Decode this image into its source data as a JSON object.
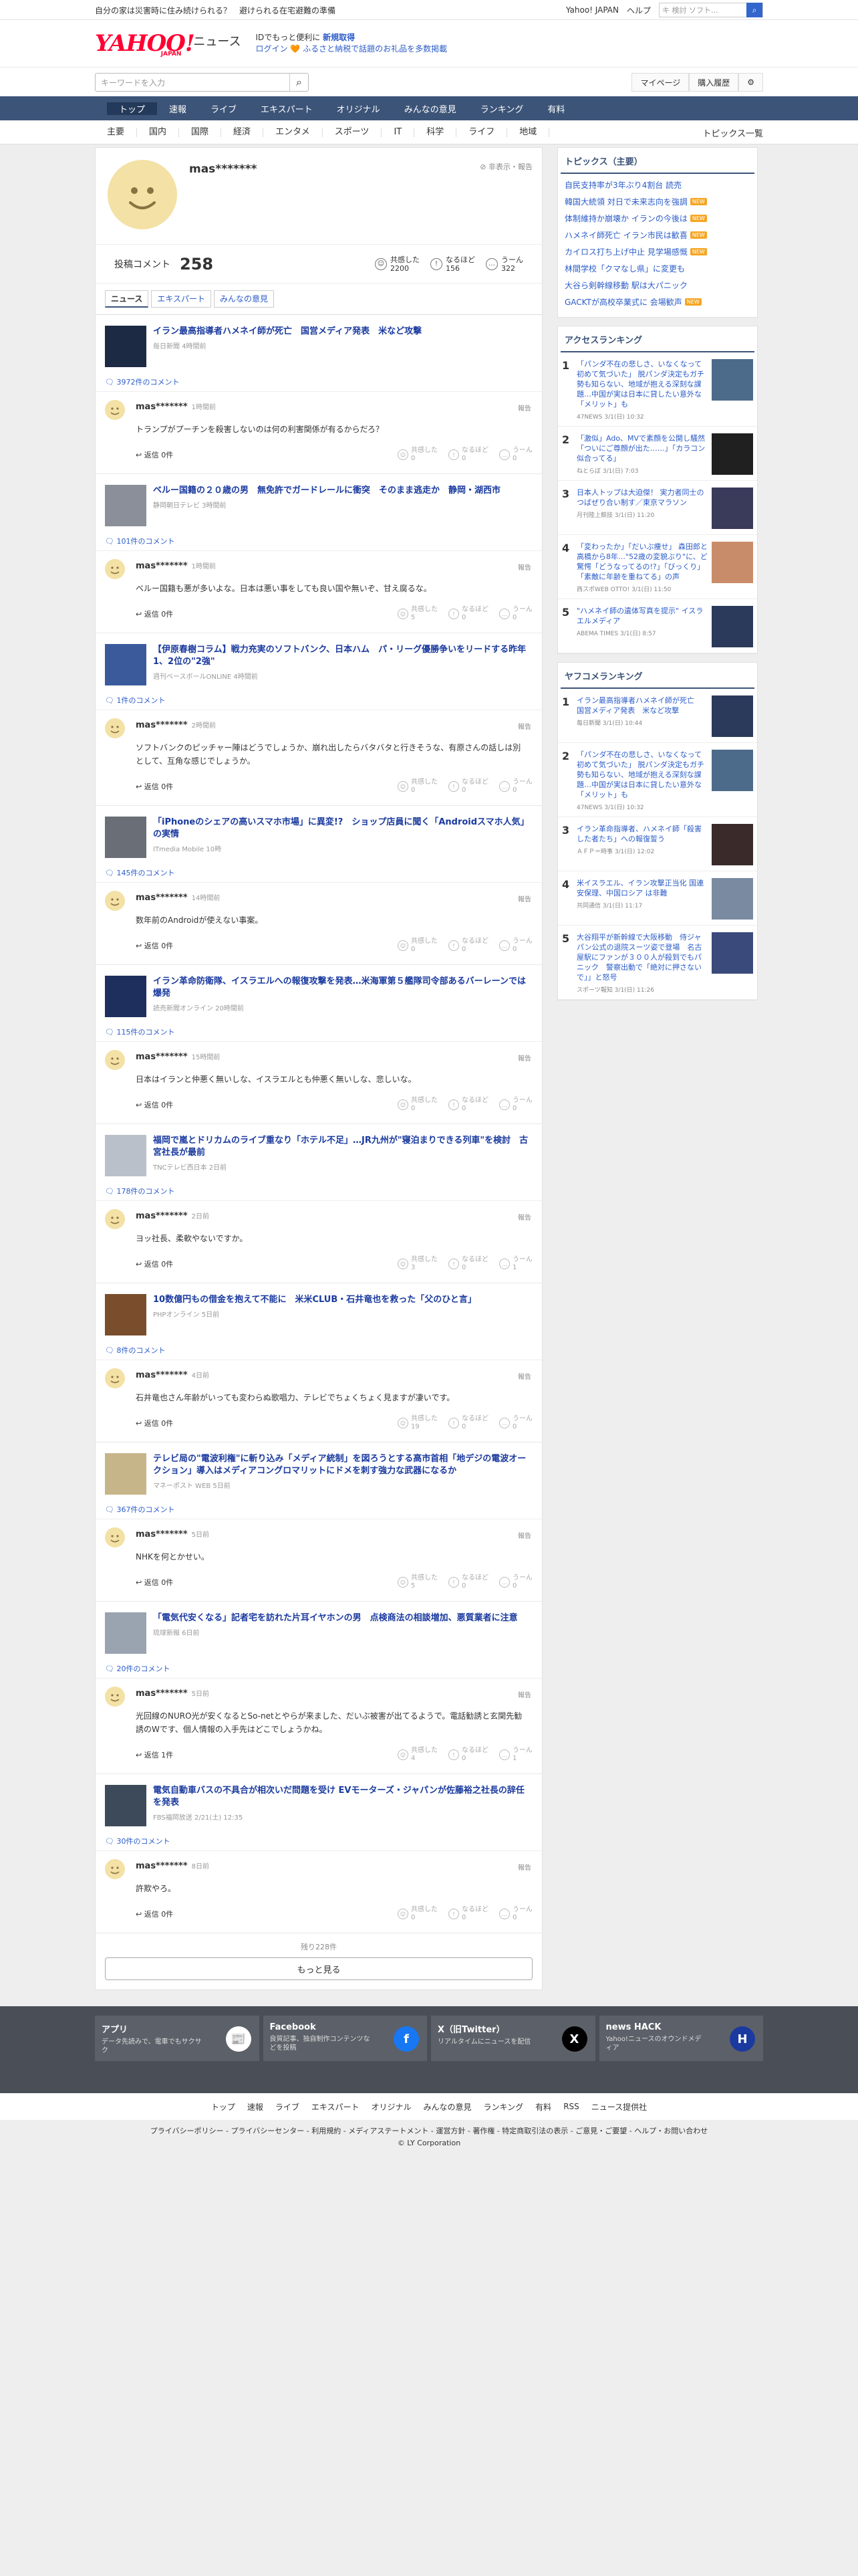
{
  "topbar": {
    "notice": "自分の家は災害時に住み続けられる？　避けられる在宅避難の準備",
    "links": [
      "Yahoo! JAPAN",
      "ヘルプ"
    ],
    "search_placeholder": "ウェブ検索",
    "search_value": "キ 検討 ソフト...",
    "search_icon": "search-icon"
  },
  "header": {
    "logo": "YAHOO!",
    "logo_sub": "JAPAN",
    "news": "ニュース",
    "promo1": "IDでもっと便利に",
    "promo1b": "新規取得",
    "promo2": "ログイン",
    "promo2b": "ふるさと納税で話題のお礼品を多数掲載"
  },
  "search": {
    "placeholder": "キーワードを入力",
    "mypage": "マイページ",
    "history": "購入履歴",
    "gear": "gear-icon"
  },
  "nav1": [
    "トップ",
    "速報",
    "ライブ",
    "エキスパート",
    "オリジナル",
    "みんなの意見",
    "ランキング",
    "有料"
  ],
  "nav2": [
    "主要",
    "国内",
    "国際",
    "経済",
    "エンタメ",
    "スポーツ",
    "IT",
    "科学",
    "ライフ",
    "地域"
  ],
  "nav2_right": "トピックス一覧",
  "profile": {
    "name": "mas*******",
    "hide": "非表示・報告",
    "posts_label": "投稿コメント",
    "posts": "258",
    "reactions": [
      {
        "l": "共感した",
        "v": "2200"
      },
      {
        "l": "なるほど",
        "v": "156"
      },
      {
        "l": "うーん",
        "v": "322"
      }
    ]
  },
  "tabs": [
    "ニュース",
    "エキスパート",
    "みんなの意見"
  ],
  "entries": [
    {
      "title": "イラン最高指導者ハメネイ師が死亡　国営メディア発表　米など攻撃",
      "src": "毎日新聞 4時間前",
      "count": "3972件のコメント",
      "user": "mas*******",
      "time": "1時間前",
      "text": "トランプがプーチンを殺害しないのは何の利害関係が有るからだろ？",
      "reply": "返信 0件",
      "r": [
        "0",
        "0",
        "0"
      ]
    },
    {
      "title": "ベルー国籍の２０歳の男　無免許でガードレールに衝突　そのまま逃走か　静岡・湖西市",
      "src": "静岡朝日テレビ 3時間前",
      "count": "101件のコメント",
      "user": "mas*******",
      "time": "1時間前",
      "text": "ベルー国籍も悪が多いよな。日本は悪い事をしても良い国や無いぞ、甘え腐るな。",
      "reply": "返信 0件",
      "r": [
        "5",
        "0",
        "0"
      ]
    },
    {
      "title": "【伊原春樹コラム】戦力充実のソフトバンク、日本ハム　パ・リーグ優勝争いをリードする昨年1、2位の\"2強\"",
      "src": "週刊ベースボールONLINE 4時間前",
      "count": "1件のコメント",
      "user": "mas*******",
      "time": "2時間前",
      "text": "ソフトバンクのピッチャー陣はどうでしょうか、崩れ出したらバタバタと行きそうな、有原さんの話しは別として、互角な感じでしょうか。",
      "reply": "返信 0件",
      "r": [
        "0",
        "0",
        "0"
      ]
    },
    {
      "title": "「iPhoneのシェアの高いスマホ市場」に異変!?　ショップ店員に聞く「Androidスマホ人気」の実情",
      "src": "ITmedia Mobile 10時",
      "count": "145件のコメント",
      "user": "mas*******",
      "time": "14時間前",
      "text": "数年前のAndroidが使えない事案。",
      "reply": "返信 0件",
      "r": [
        "0",
        "0",
        "0"
      ]
    },
    {
      "title": "イラン革命防衛隊、イスラエルへの報復攻撃を発表…米海軍第５艦隊司令部あるバーレーンでは爆発",
      "src": "読売新聞オンライン 20時間前",
      "count": "115件のコメント",
      "user": "mas*******",
      "time": "15時間前",
      "text": "日本はイランと仲悪く無いしな、イスラエルとも仲悪く無いしな、悲しいな。",
      "reply": "返信 0件",
      "r": [
        "0",
        "0",
        "0"
      ]
    },
    {
      "title": "福岡で嵐とドリカムのライブ重なり「ホテル不足」…JR九州が\"寝泊まりできる列車\"を検討　古宮社長が最前",
      "src": "TNCテレビ西日本 2日前",
      "count": "178件のコメント",
      "user": "mas*******",
      "time": "2日前",
      "text": "ヨッ社長、柔軟やないですか。",
      "reply": "返信 0件",
      "r": [
        "3",
        "0",
        "1"
      ]
    },
    {
      "title": "10数億円もの借金を抱えて不能に　米米CLUB・石井竜也を救った「父のひと言」",
      "src": "PHPオンライン 5日前",
      "count": "8件のコメント",
      "user": "mas*******",
      "time": "4日前",
      "text": "石井竜也さん年齢がいっても変わらぬ歌唱力、テレビでちょくちょく見ますが凄いです。",
      "reply": "返信 0件",
      "r": [
        "19",
        "0",
        "0"
      ]
    },
    {
      "title": "テレビ局の\"電波利権\"に斬り込み「メディア統制」を図ろうとする高市首相「地デジの電波オークション」導入はメディアコングロマリットにドメを刺す強力な武器になるか",
      "src": "マネーポスト WEB 5日前",
      "count": "367件のコメント",
      "user": "mas*******",
      "time": "5日前",
      "text": "NHKを何とかせい。",
      "reply": "返信 0件",
      "r": [
        "5",
        "0",
        "0"
      ]
    },
    {
      "title": "「電気代安くなる」記者宅を訪れた片耳イヤホンの男　点検商法の相談増加、悪質業者に注意",
      "src": "琉球新報 6日前",
      "count": "20件のコメント",
      "user": "mas*******",
      "time": "5日前",
      "text": "光回線のNURO光が安くなるとSo-netとやらが来ました、だいぶ被害が出てるようで。電話勧誘と玄関先勧誘のWです、個人情報の入手先はどこでしょうかね。",
      "reply": "返信 1件",
      "r": [
        "4",
        "0",
        "1"
      ]
    },
    {
      "title": "電気自動車バスの不具合が相次いだ問題を受け EVモーターズ・ジャパンが佐藤裕之社長の辞任を発表",
      "src": "FBS福岡放送 2/21(土) 12:35",
      "count": "30件のコメント",
      "user": "mas*******",
      "time": "8日前",
      "text": "許欺やろ。",
      "reply": "返信 0件",
      "r": [
        "0",
        "0",
        "0"
      ]
    }
  ],
  "more": {
    "count": "残り228件",
    "button": "もっと見る"
  },
  "topics": {
    "title": "トピックス（主要）",
    "items": [
      {
        "t": "自民支持率が3年ぶり4割台 読売",
        "n": ""
      },
      {
        "t": "韓国大統領 対日で未来志向を強調",
        "n": "NEW"
      },
      {
        "t": "体制維持か崩壊か イランの今後は",
        "n": "NEW"
      },
      {
        "t": "ハメネイ師死亡 イラン市民は歓喜",
        "n": "NEW"
      },
      {
        "t": "カイロス打ち上げ中止 見学場感慨",
        "n": "NEW"
      },
      {
        "t": "林間学校「クマなし県」に変更も",
        "n": ""
      },
      {
        "t": "大谷ら剣幹線移動 駅は大パニック",
        "n": ""
      },
      {
        "t": "GACKTが高校卒業式に 会場歓声",
        "n": "NEW"
      }
    ]
  },
  "access": {
    "title": "アクセスランキング",
    "items": [
      {
        "t": "「パンダ不在の悲しさ、いなくなって初めて気づいた」 脱パンダ決定もガチ勢も知らない、地域が抱える深刻な課題…中国が実は日本に貸したい意外な「メリット」も",
        "s": "47NEWS 3/1(日) 10:32"
      },
      {
        "t": "「激似」Ado、MVで素顔を公開し騒然「ついにご尊顔が出た……」「カラコン似合ってる」",
        "s": "ねとらぼ 3/1(日) 7:03"
      },
      {
        "t": "日本人トップは大迫傑！ 実力者同士のつばぜり合い制す／東京マラソン",
        "s": "月刊陸上競技 3/1(日) 11:20"
      },
      {
        "t": "「変わったか」「だいぶ痩せ」 森田郎と高橋から8年…\"52歳の変貌ぶり\"に、ど驚愕「どうなってるの!?」「びっくり」「素敵に年齢を重ねてる」の声",
        "s": "西スポWEB OTTO! 3/1(日) 11:50"
      },
      {
        "t": "\"ハメネイ師の遺体写真を提示\" イスラエルメディア",
        "s": "ABEMA TIMES 3/1(日) 8:57"
      }
    ]
  },
  "yafuko": {
    "title": "ヤフコメランキング",
    "items": [
      {
        "t": "イラン最高指導者ハメネイ師が死亡　国営メディア発表　米など攻撃",
        "s": "毎日新聞 3/1(日) 10:44"
      },
      {
        "t": "「パンダ不在の悲しさ、いなくなって初めて気づいた」 脱パンダ決定もガチ勢も知らない、地域が抱える深刻な課題…中国が実は日本に貸したい意外な「メリット」も",
        "s": "47NEWS 3/1(日) 10:32"
      },
      {
        "t": "イラン革命指導者、ハメネイ師「殺害した者たち」への報復誓う",
        "s": "ＡＦＰ＝時事 3/1(日) 12:02"
      },
      {
        "t": "米イスラエル、イラン攻撃正当化 国連安保理、中国ロシア は非難",
        "s": "共同通信 3/1(日) 11:17"
      },
      {
        "t": "大谷翔平が新幹線で大阪移動　侍ジャパン公式の退院スーツ姿で登場　名古屋駅にファンが３００人が殺到でもパニック　警察出動で「絶対に押さないで」」と怒号",
        "s": "スポーツ報知 3/1(日) 11:26"
      }
    ]
  },
  "footer": {
    "cards": [
      {
        "h": "アプリ",
        "d": "データ先読みで、電車でもサクサク"
      },
      {
        "h": "Facebook",
        "d": "良質記事、独自制作コンテンツなどを投稿"
      },
      {
        "h": "X（旧Twitter）",
        "d": "リアルタイムにニュースを配信"
      },
      {
        "h": "news HACK",
        "d": "Yahoo!ニュースのオウンドメディア"
      }
    ],
    "nav": [
      "トップ",
      "速報",
      "ライブ",
      "エキスパート",
      "オリジナル",
      "みんなの意見",
      "ランキング",
      "有料",
      "RSS",
      "ニュース提供社"
    ],
    "links": "プライバシーポリシー - プライバシーセンター - 利用規約 - メディアステートメント - 運営方針 - 著作権 - 特定商取引法の表示 - ご意見・ご要望 - ヘルプ・お問い合わせ",
    "copy": "© LY Corporation"
  },
  "colors": {
    "nav": "#3c5478",
    "link": "#1a3a9f",
    "avatar": "#f3e1a5",
    "logo": "#ff0033"
  }
}
